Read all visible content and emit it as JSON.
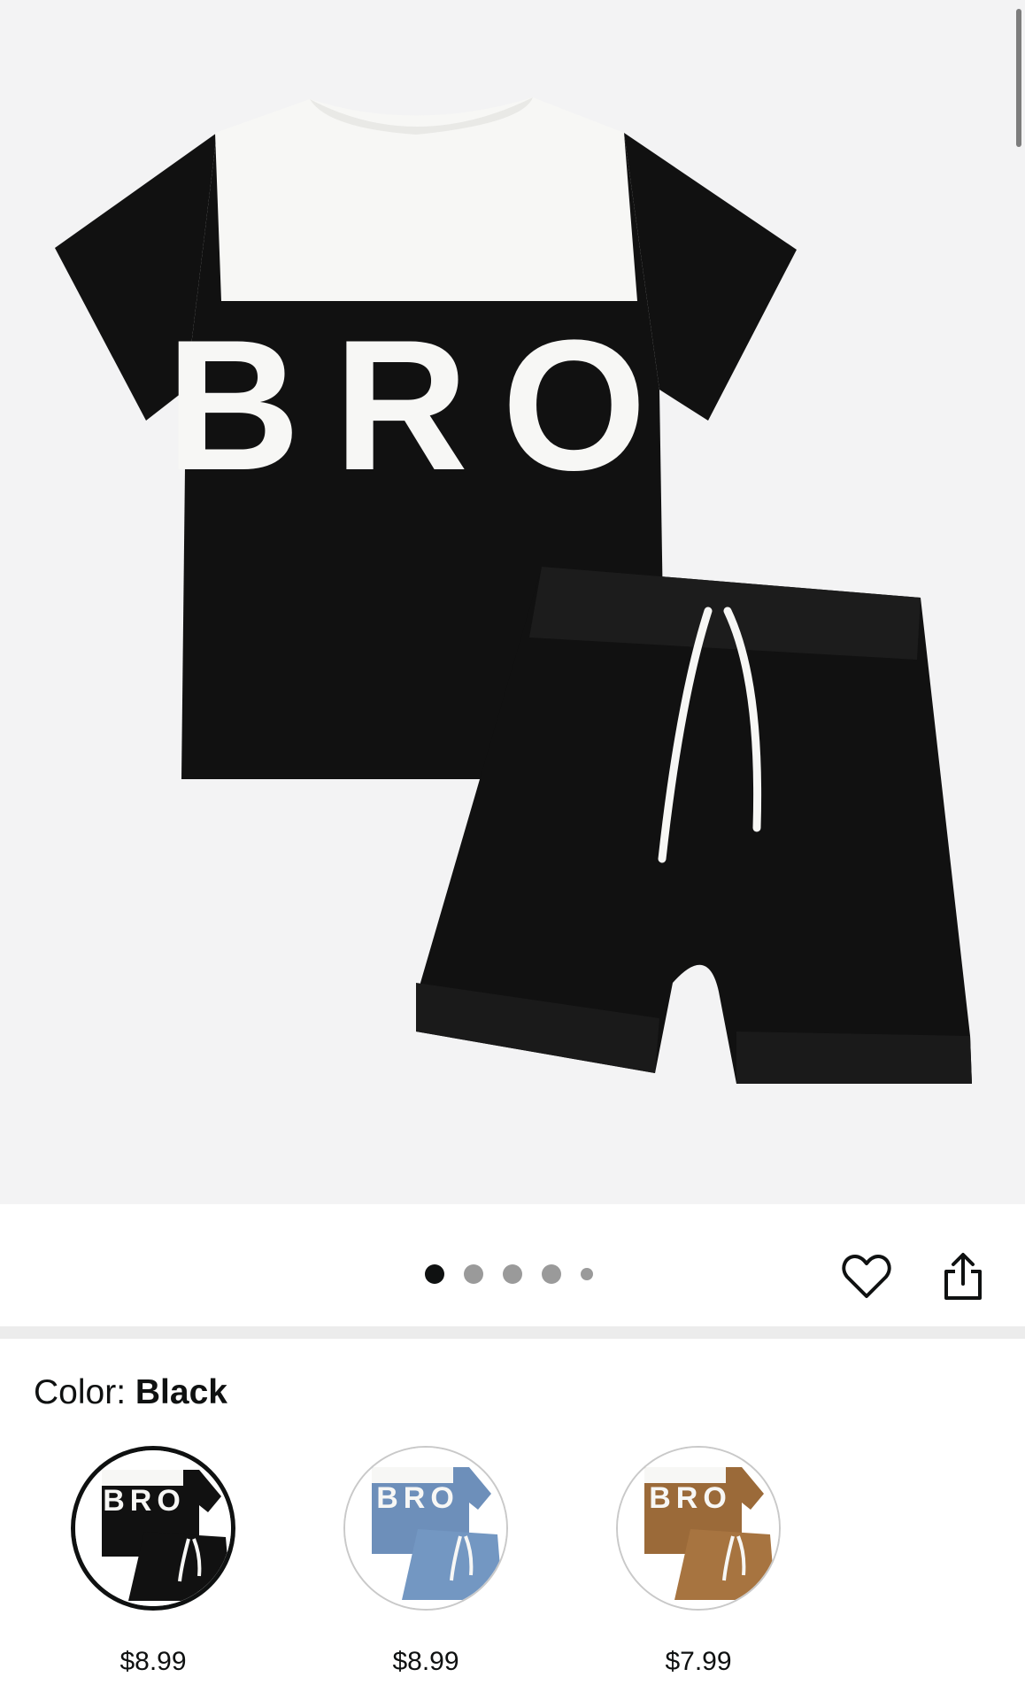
{
  "product_image": {
    "shirt_print": "BRO",
    "colors": {
      "black": "#111111",
      "white": "#f7f7f5",
      "background": "#f3f3f4"
    }
  },
  "carousel": {
    "count": 5,
    "active_index": 0
  },
  "actions": {
    "favorite_icon": "heart-icon",
    "share_icon": "share-icon"
  },
  "color_selector": {
    "label": "Color: ",
    "selected_value": "Black",
    "options": [
      {
        "name": "Black",
        "price": "$8.99",
        "print": "BRO",
        "shirt_color": "#111111",
        "shorts_color": "#111111",
        "selected": true
      },
      {
        "name": "Blue",
        "price": "$8.99",
        "print": "BRO",
        "shirt_color": "#6d8fba",
        "shorts_color": "#6d8fba",
        "selected": false
      },
      {
        "name": "Brown",
        "price": "$7.99",
        "print": "BRO",
        "shirt_color": "#9b6a39",
        "shorts_color": "#9b6a39",
        "selected": false
      }
    ]
  }
}
